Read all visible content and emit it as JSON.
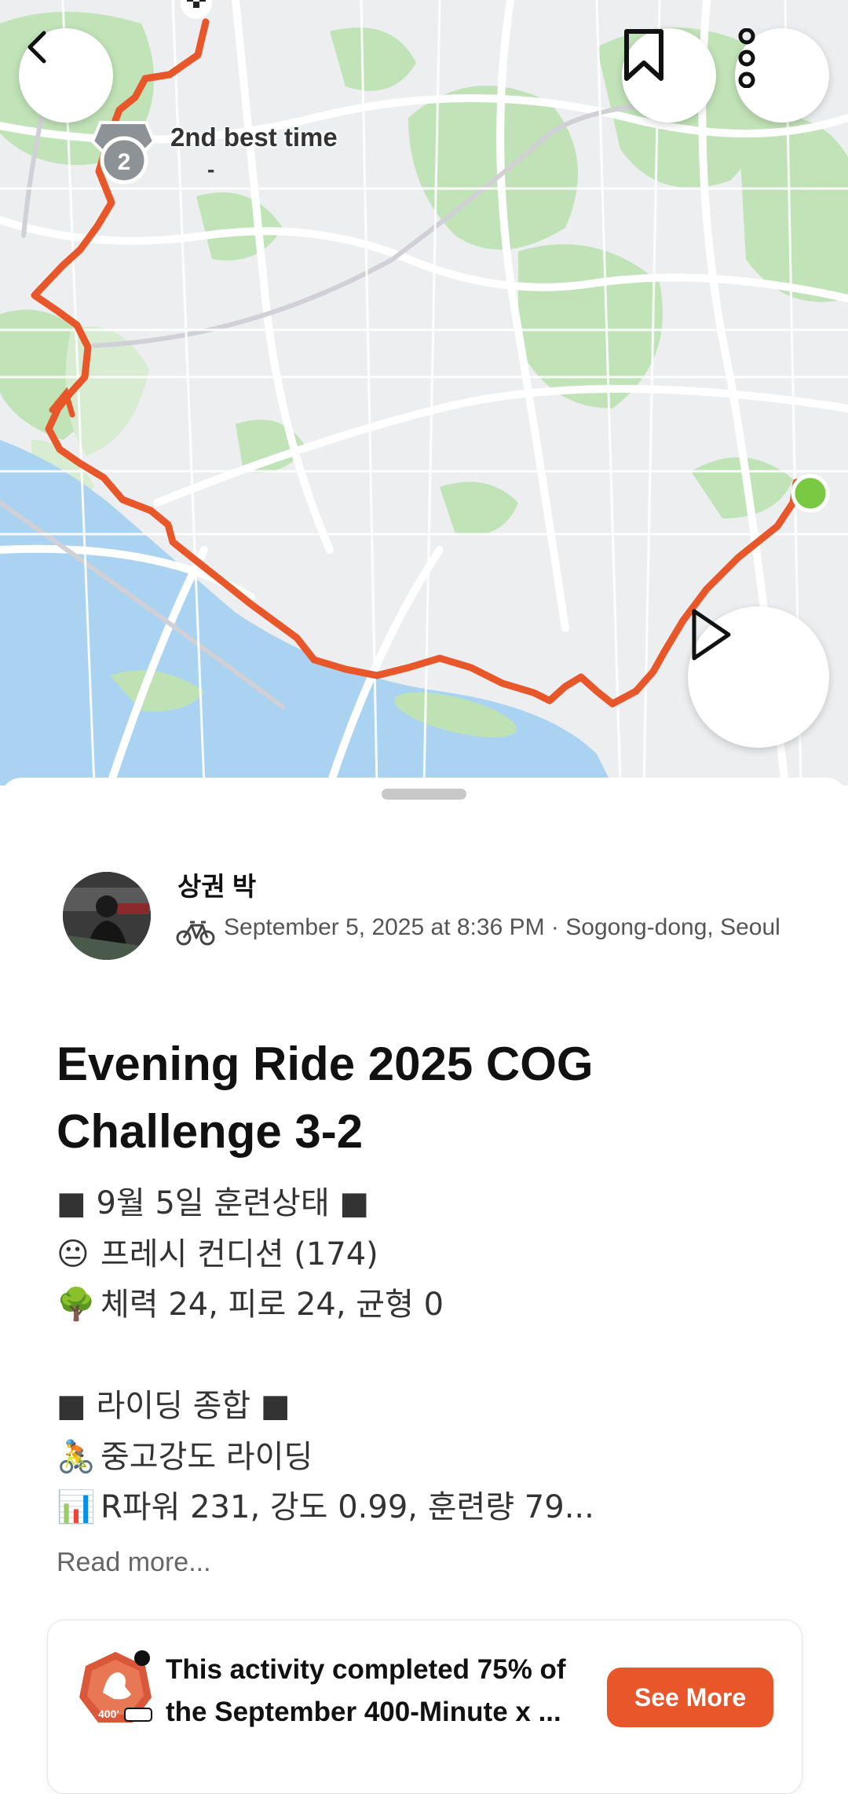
{
  "map": {
    "medal_label": "2nd best time",
    "medal_sub": "-",
    "medal_number": "2",
    "colors": {
      "route": "#e8572a",
      "water": "#a9d3f0",
      "park": "#bfe2b4",
      "start": "#7ac943"
    }
  },
  "nav": {
    "back_icon": "chevron-left-icon",
    "bookmark_icon": "bookmark-icon",
    "more_icon": "more-vertical-icon",
    "play_icon": "play-icon"
  },
  "athlete": {
    "name": "상권 박",
    "meta": "September 5, 2025 at 8:36 PM · Sogong-dong, Seoul",
    "activity_icon": "bike-icon"
  },
  "activity": {
    "title": "Evening Ride 2025 COG Challenge 3-2",
    "description": [
      {
        "emoji": "",
        "text": "■ 9월 5일 훈련상태 ■"
      },
      {
        "emoji": "😐",
        "text": "프레시 컨디션 (174)"
      },
      {
        "emoji": "🌳",
        "text": "체력 24, 피로 24, 균형 0"
      },
      {
        "emoji": "",
        "text": ""
      },
      {
        "emoji": "",
        "text": "■ 라이딩 종합 ■"
      },
      {
        "emoji": "🚴",
        "text": "중고강도 라이딩"
      },
      {
        "emoji": "📊",
        "text": "R파워 231, 강도 0.99, 훈련량 79..."
      }
    ],
    "read_more": "Read more..."
  },
  "challenge": {
    "text_line1": "This activity completed 75% of",
    "text_line2": "the September 400-Minute x ...",
    "progress_percent": 75,
    "button_label": "See More",
    "badge_number": "400'"
  }
}
